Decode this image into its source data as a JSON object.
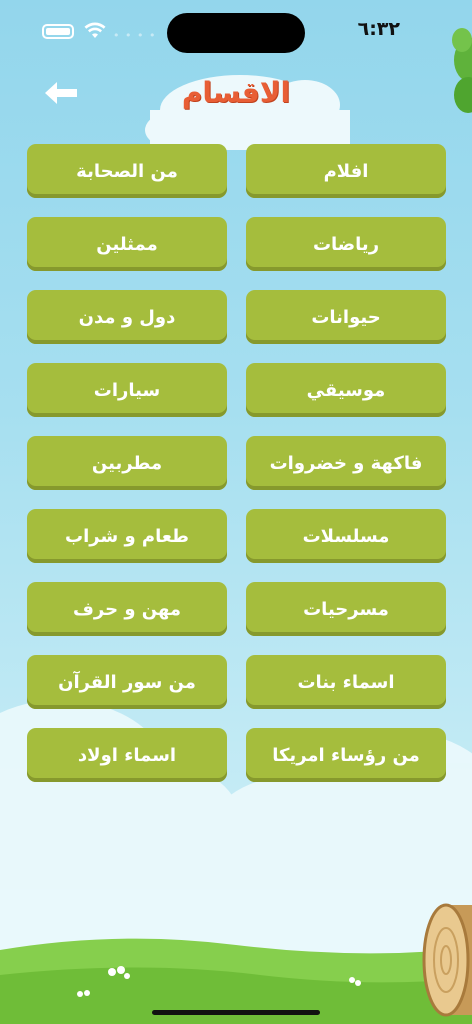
{
  "status_bar": {
    "time": "٦:٣٢"
  },
  "header": {
    "title": "الاقسام"
  },
  "categories": [
    "افلام",
    "من الصحابة",
    "رياضات",
    "ممثلين",
    "حيوانات",
    "دول و مدن",
    "موسيقي",
    "سيارات",
    "فاكهة و خضروات",
    "مطربين",
    "مسلسلات",
    "طعام و شراب",
    "مسرحيات",
    "مهن و حرف",
    "اسماء بنات",
    "من سور القرآن",
    "من رؤساء امريكا",
    "اسماء اولاد"
  ],
  "colors": {
    "button": "#a5bd3d",
    "title": "#e85e35",
    "grass": "#7ac943"
  }
}
